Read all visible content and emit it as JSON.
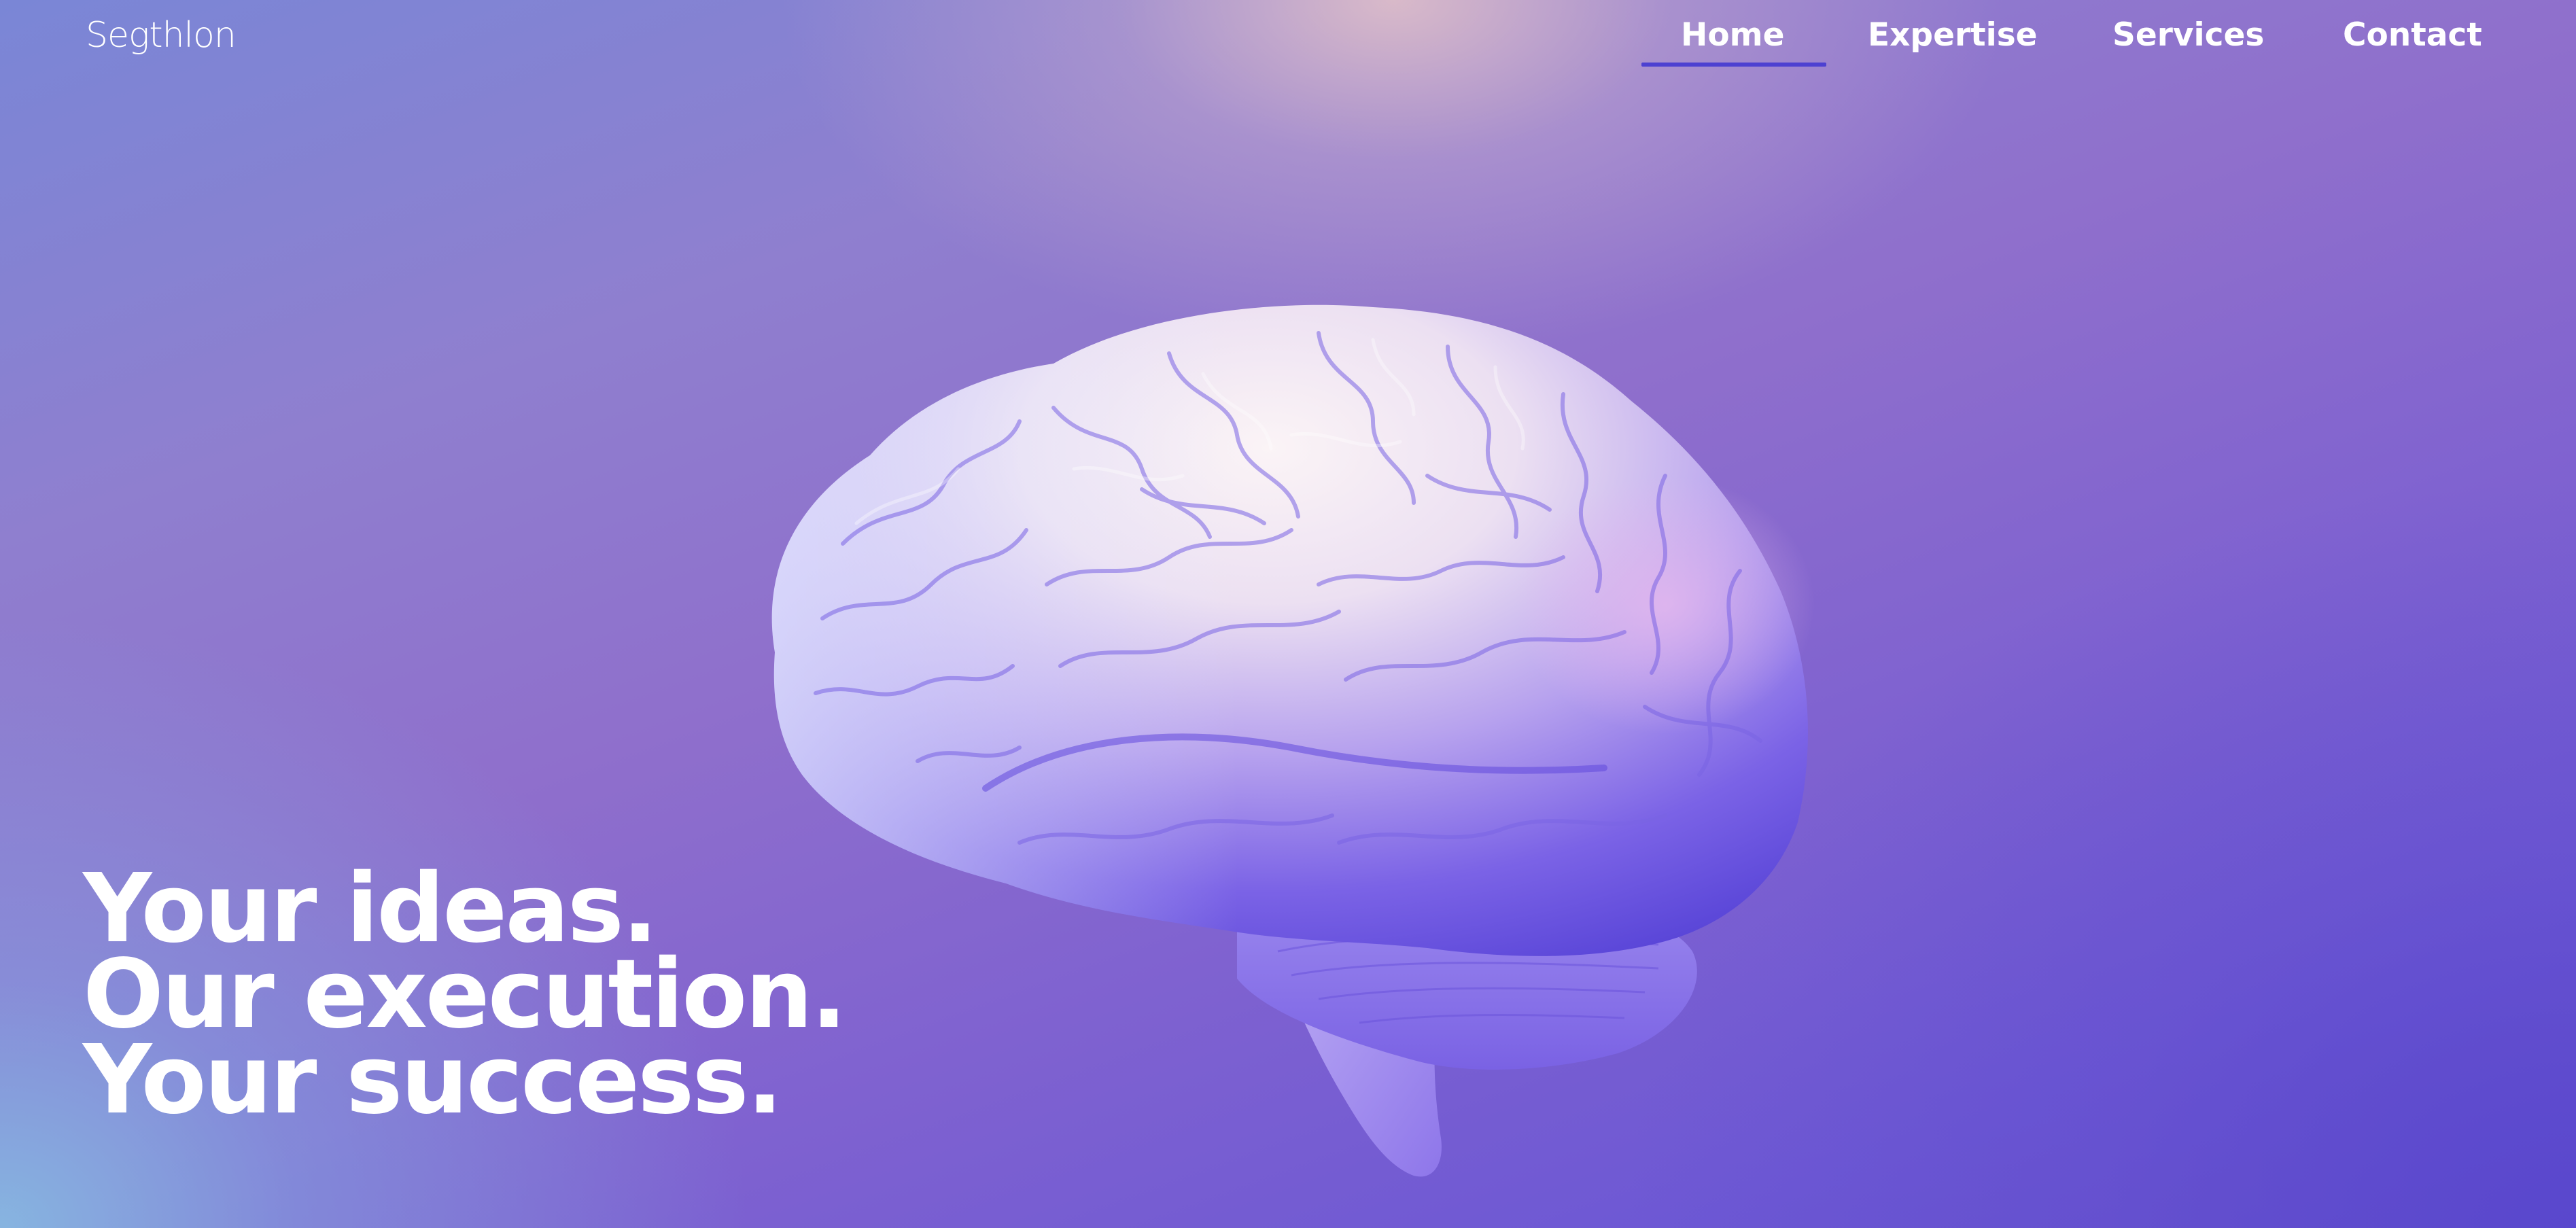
{
  "brand": {
    "logo_text": "Segthlon"
  },
  "nav": {
    "items": [
      {
        "label": "Home",
        "active": true
      },
      {
        "label": "Expertise",
        "active": false
      },
      {
        "label": "Services",
        "active": false
      },
      {
        "label": "Contact",
        "active": false
      }
    ],
    "active_underline_color": "#4d41d1"
  },
  "hero": {
    "lines": [
      "Your ideas.",
      "Our execution.",
      "Your success."
    ]
  },
  "illustration": {
    "icon": "brain-image"
  },
  "colors": {
    "background_start": "#7a86d6",
    "background_end": "#6450cc",
    "glow_top": "#e6c4c8",
    "text": "#ffffff"
  }
}
